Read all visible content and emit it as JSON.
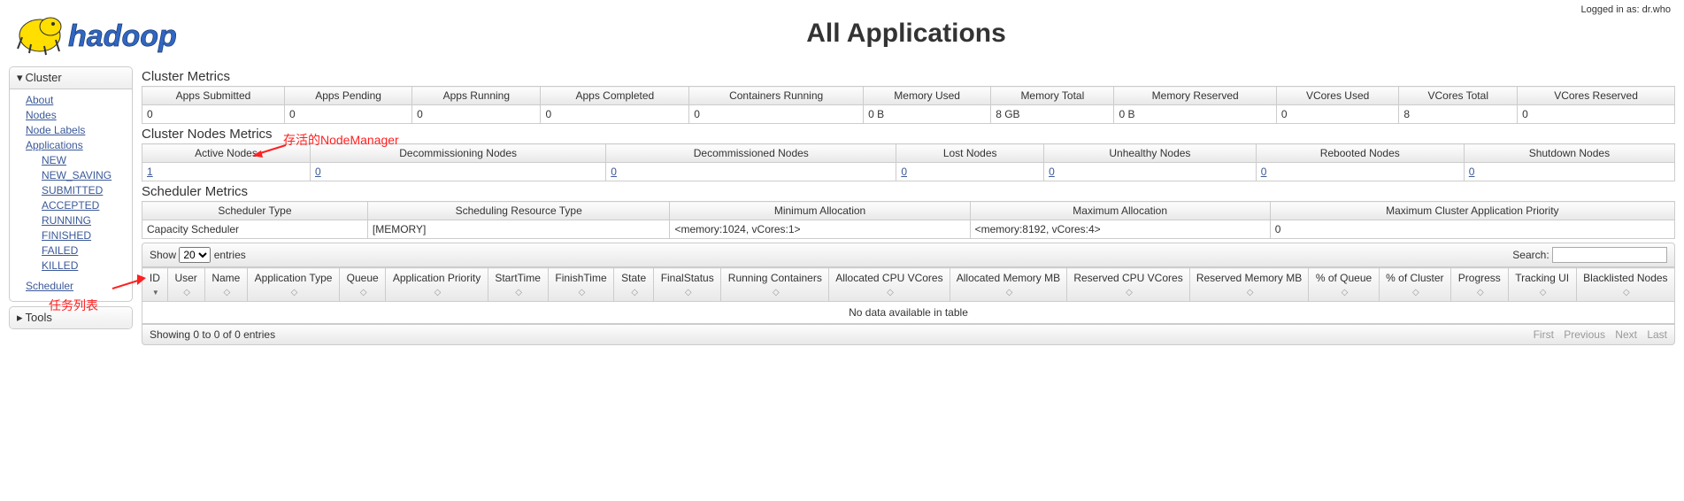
{
  "login_text": "Logged in as: dr.who",
  "page_title": "All Applications",
  "sidebar": {
    "cluster_label": "Cluster",
    "tools_label": "Tools",
    "links": {
      "about": "About",
      "nodes": "Nodes",
      "node_labels": "Node Labels",
      "applications": "Applications",
      "new": "NEW",
      "new_saving": "NEW_SAVING",
      "submitted": "SUBMITTED",
      "accepted": "ACCEPTED",
      "running": "RUNNING",
      "finished": "FINISHED",
      "failed": "FAILED",
      "killed": "KILLED",
      "scheduler": "Scheduler"
    }
  },
  "cluster_metrics": {
    "title": "Cluster Metrics",
    "headers": [
      "Apps Submitted",
      "Apps Pending",
      "Apps Running",
      "Apps Completed",
      "Containers Running",
      "Memory Used",
      "Memory Total",
      "Memory Reserved",
      "VCores Used",
      "VCores Total",
      "VCores Reserved"
    ],
    "values": [
      "0",
      "0",
      "0",
      "0",
      "0",
      "0 B",
      "8 GB",
      "0 B",
      "0",
      "8",
      "0"
    ]
  },
  "nodes_metrics": {
    "title": "Cluster Nodes Metrics",
    "headers": [
      "Active Nodes",
      "Decommissioning Nodes",
      "Decommissioned Nodes",
      "Lost Nodes",
      "Unhealthy Nodes",
      "Rebooted Nodes",
      "Shutdown Nodes"
    ],
    "values": [
      "1",
      "0",
      "0",
      "0",
      "0",
      "0",
      "0"
    ]
  },
  "scheduler_metrics": {
    "title": "Scheduler Metrics",
    "headers": [
      "Scheduler Type",
      "Scheduling Resource Type",
      "Minimum Allocation",
      "Maximum Allocation",
      "Maximum Cluster Application Priority"
    ],
    "values": [
      "Capacity Scheduler",
      "[MEMORY]",
      "<memory:1024, vCores:1>",
      "<memory:8192, vCores:4>",
      "0"
    ]
  },
  "datatable": {
    "show_label_pre": "Show",
    "show_label_post": "entries",
    "show_value": "20",
    "search_label": "Search:",
    "columns": [
      "ID",
      "User",
      "Name",
      "Application Type",
      "Queue",
      "Application Priority",
      "StartTime",
      "FinishTime",
      "State",
      "FinalStatus",
      "Running Containers",
      "Allocated CPU VCores",
      "Allocated Memory MB",
      "Reserved CPU VCores",
      "Reserved Memory MB",
      "% of Queue",
      "% of Cluster",
      "Progress",
      "Tracking UI",
      "Blacklisted Nodes"
    ],
    "no_data": "No data available in table",
    "info": "Showing 0 to 0 of 0 entries",
    "pager": {
      "first": "First",
      "prev": "Previous",
      "next": "Next",
      "last": "Last"
    }
  },
  "annotations": {
    "active_nodes": "存活的NodeManager",
    "task_list": "任务列表"
  }
}
